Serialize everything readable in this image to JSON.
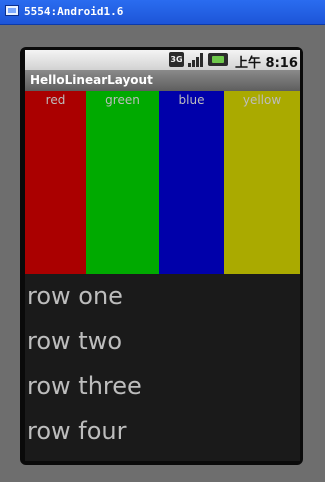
{
  "window": {
    "title": "5554:Android1.6"
  },
  "status_bar": {
    "network": "3G",
    "time": "上午 8:16"
  },
  "app": {
    "title": "HelloLinearLayout"
  },
  "columns": [
    {
      "label": "red",
      "color": "#aa0000"
    },
    {
      "label": "green",
      "color": "#00aa00"
    },
    {
      "label": "blue",
      "color": "#0000aa"
    },
    {
      "label": "yellow",
      "color": "#aaaa00"
    }
  ],
  "rows": [
    "row one",
    "row two",
    "row three",
    "row four"
  ],
  "icons": [
    "window-app-icon",
    "network-3g-icon",
    "signal-icon",
    "battery-icon"
  ]
}
